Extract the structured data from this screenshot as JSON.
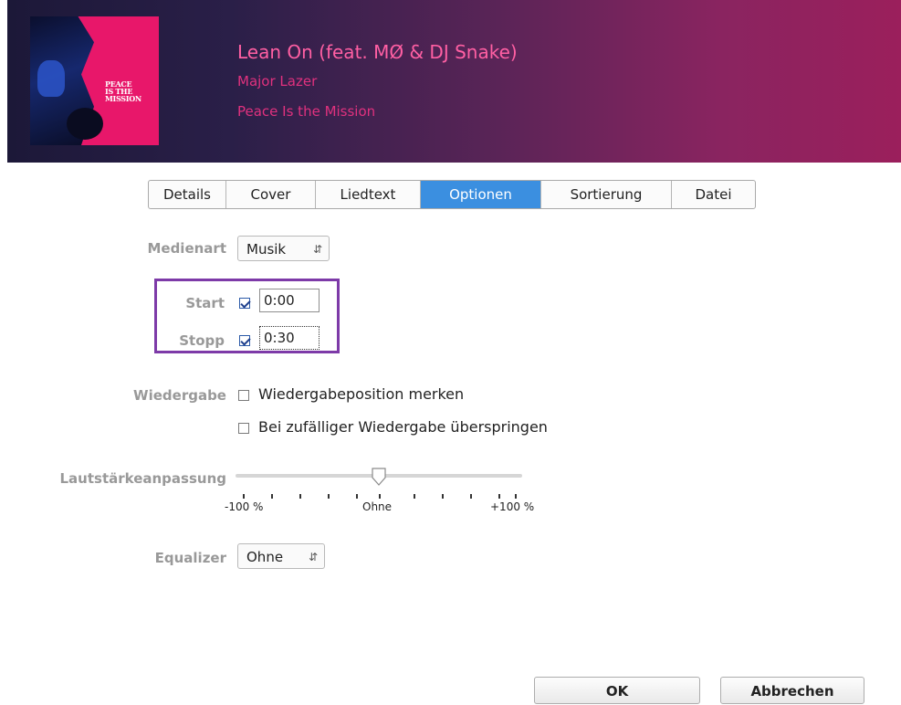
{
  "header": {
    "title": "Lean On (feat. MØ & DJ Snake)",
    "artist": "Major Lazer",
    "album": "Peace Is the Mission",
    "cover_text": "PEACE IS THE MISSION"
  },
  "tabs": [
    {
      "label": "Details",
      "active": false
    },
    {
      "label": "Cover",
      "active": false
    },
    {
      "label": "Liedtext",
      "active": false
    },
    {
      "label": "Optionen",
      "active": true
    },
    {
      "label": "Sortierung",
      "active": false
    },
    {
      "label": "Datei",
      "active": false
    }
  ],
  "media_kind": {
    "label": "Medienart",
    "value": "Musik"
  },
  "start": {
    "label": "Start",
    "checked": true,
    "value": "0:00"
  },
  "stop": {
    "label": "Stopp",
    "checked": true,
    "value": "0:30"
  },
  "playback": {
    "label": "Wiedergabe",
    "remember_position": {
      "label": "Wiedergabeposition merken",
      "checked": false
    },
    "skip_shuffle": {
      "label": "Bei zufälliger Wiedergabe überspringen",
      "checked": false
    }
  },
  "volume": {
    "label": "Lautstärkeanpassung",
    "min_label": "-100 %",
    "mid_label": "Ohne",
    "max_label": "+100 %",
    "value_percent": 0
  },
  "equalizer": {
    "label": "Equalizer",
    "value": "Ohne"
  },
  "buttons": {
    "ok": "OK",
    "cancel": "Abbrechen"
  },
  "colors": {
    "accent": "#3b8fe0",
    "highlight_box": "#7d3aa8",
    "title_pink": "#ff5fa3"
  }
}
